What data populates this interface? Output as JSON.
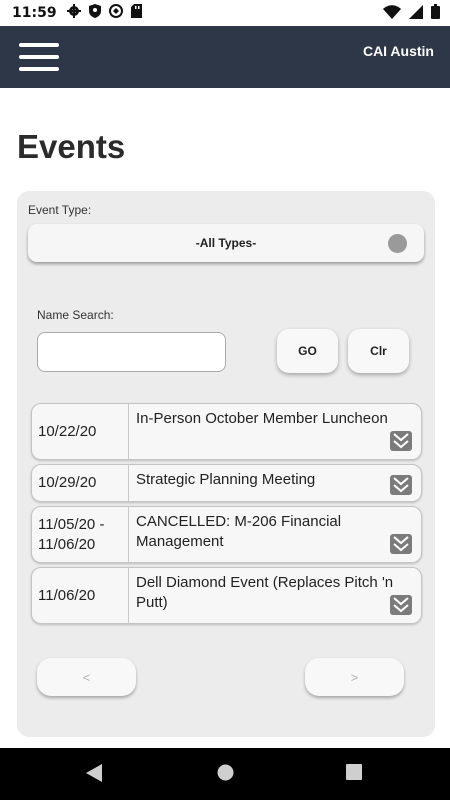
{
  "status_bar": {
    "time": "11:59",
    "icons": [
      "gear-icon",
      "shield-icon",
      "vpn-icon",
      "sd-card-icon",
      "wifi-icon",
      "signal-icon",
      "battery-icon"
    ]
  },
  "app_bar": {
    "title": "CAI Austin",
    "menu_icon": "hamburger-menu-icon"
  },
  "page": {
    "title": "Events"
  },
  "filter": {
    "event_type_label": "Event Type:",
    "event_type_value": "-All Types-"
  },
  "search": {
    "label": "Name Search:",
    "value": "",
    "go_label": "GO",
    "clear_label": "Clr"
  },
  "events": [
    {
      "date": "10/22/20",
      "name": "In-Person October Member Luncheon"
    },
    {
      "date": "10/29/20",
      "name": "Strategic Planning Meeting"
    },
    {
      "date": "11/05/20 - 11/06/20",
      "name": "CANCELLED: M-206 Financial Management"
    },
    {
      "date": "11/06/20",
      "name": "Dell Diamond Event (Replaces Pitch 'n Putt)"
    }
  ],
  "pagination": {
    "prev_label": "<",
    "next_label": ">"
  },
  "colors": {
    "app_bar": "#2e3748",
    "panel": "#ececec",
    "expand_icon": "#7b7b7b"
  }
}
